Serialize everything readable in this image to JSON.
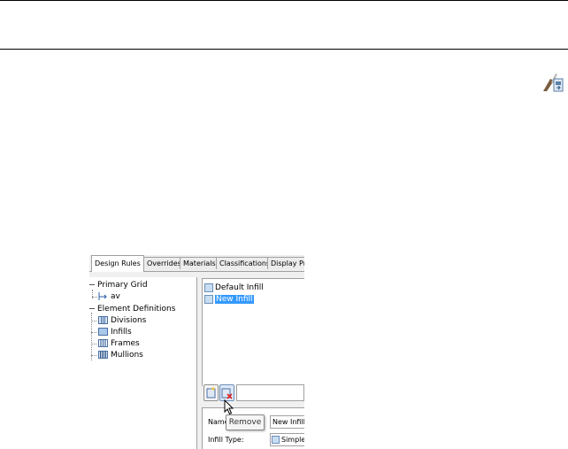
{
  "dialog": {
    "tabs": [
      {
        "label": "Design Rules",
        "active": true
      },
      {
        "label": "Overrides"
      },
      {
        "label": "Materials"
      },
      {
        "label": "Classifications"
      },
      {
        "label": "Display Pro"
      }
    ],
    "tree": {
      "primary_grid": "Primary Grid",
      "primary_grid_child": "av",
      "element_definitions": "Element Definitions",
      "children": [
        "Divisions",
        "Infills",
        "Frames",
        "Mullions"
      ]
    },
    "list": {
      "items": [
        {
          "label": "Default Infill",
          "selected": false
        },
        {
          "label": "New Infill",
          "selected": true
        }
      ]
    },
    "tooltip": "Remove",
    "properties": {
      "name_label": "Name",
      "name_value": "New Infill",
      "infill_type_label": "Infill Type:",
      "infill_type_value": "Simple"
    }
  },
  "colors": {
    "selection": "#3399ff",
    "dialog_bg": "#f0f0f0"
  },
  "icons": [
    "export-icon",
    "tree-grid-icon",
    "division-icon",
    "infill-icon",
    "frame-icon",
    "mullion-icon",
    "new-item-icon",
    "remove-icon",
    "cursor-icon"
  ]
}
